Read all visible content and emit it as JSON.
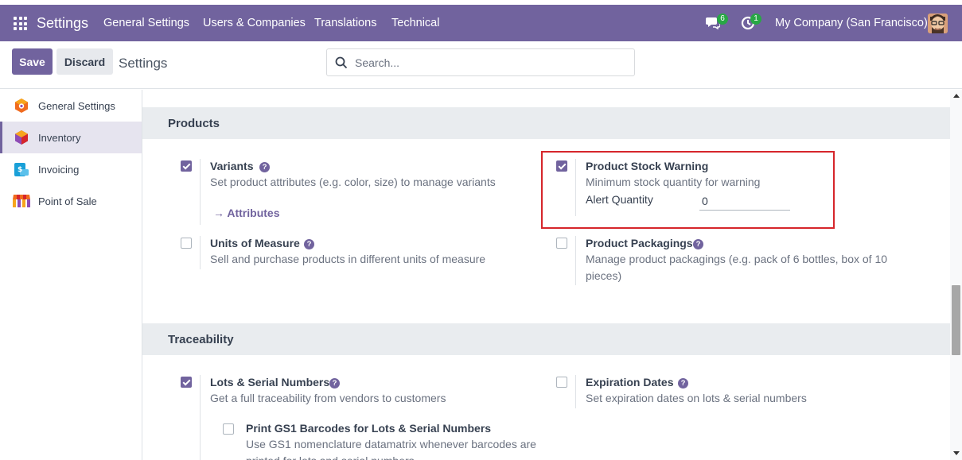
{
  "navbar": {
    "brand": "Settings",
    "menu": [
      "General Settings",
      "Users & Companies",
      "Translations",
      "Technical"
    ],
    "messages_count": "6",
    "activities_count": "1",
    "company": "My Company (San Francisco)"
  },
  "control_panel": {
    "save_label": "Save",
    "discard_label": "Discard",
    "title": "Settings",
    "search_placeholder": "Search..."
  },
  "sidebar": {
    "items": [
      {
        "label": "General Settings",
        "icon": "odoo-logo-icon",
        "active": false
      },
      {
        "label": "Inventory",
        "icon": "inventory-box-icon",
        "active": true
      },
      {
        "label": "Invoicing",
        "icon": "invoicing-icon",
        "active": false
      },
      {
        "label": "Point of Sale",
        "icon": "shop-icon",
        "active": false
      }
    ]
  },
  "sections": {
    "products": {
      "title": "Products",
      "variants": {
        "title": "Variants",
        "desc": "Set product attributes (e.g. color, size) to manage variants",
        "link": "Attributes",
        "checked": true
      },
      "units": {
        "title": "Units of Measure",
        "desc": "Sell and purchase products in different units of measure",
        "checked": false
      },
      "stock_warning": {
        "title": "Product Stock Warning",
        "desc": "Minimum stock quantity for warning",
        "qty_label": "Alert Quantity",
        "qty_value": "0",
        "checked": true
      },
      "packagings": {
        "title": "Product Packagings",
        "desc": "Manage product packagings (e.g. pack of 6 bottles, box of 10 pieces)",
        "checked": false
      }
    },
    "traceability": {
      "title": "Traceability",
      "lots": {
        "title": "Lots & Serial Numbers",
        "desc": "Get a full traceability from vendors to customers",
        "checked": true
      },
      "gs1": {
        "title": "Print GS1 Barcodes for Lots & Serial Numbers",
        "desc": "Use GS1 nomenclature datamatrix whenever barcodes are printed for lots and serial numbers",
        "checked": false
      },
      "expiration": {
        "title": "Expiration Dates",
        "desc": "Set expiration dates on lots & serial numbers",
        "checked": false
      }
    }
  },
  "help_glyph": "?",
  "link_arrow": "→",
  "colors": {
    "primary": "#71639e",
    "badge": "#28a745",
    "highlight_border": "#d6262b",
    "section_bg": "#e9ecef"
  }
}
